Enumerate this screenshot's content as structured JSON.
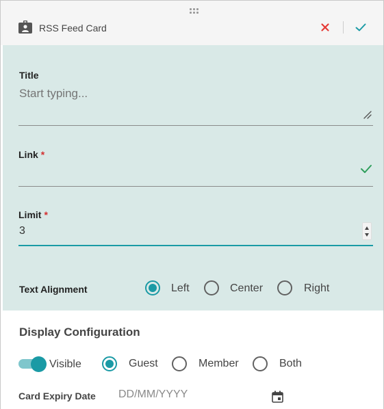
{
  "header": {
    "title": "RSS Feed Card",
    "icon": "id-badge-icon",
    "cancel_icon": "close-icon",
    "confirm_icon": "check-icon",
    "cancel_color": "#e53935",
    "confirm_color": "#1a9aa5"
  },
  "form": {
    "background": "#d9e9e7",
    "accent": "#1a9aa5",
    "title": {
      "label": "Title",
      "placeholder": "Start typing...",
      "value": ""
    },
    "link": {
      "label": "Link",
      "required_mark": "*",
      "value": "",
      "valid": true
    },
    "limit": {
      "label": "Limit",
      "required_mark": "*",
      "value": "3"
    },
    "text_alignment": {
      "label": "Text Alignment",
      "options": [
        "Left",
        "Center",
        "Right"
      ],
      "selected": "Left"
    }
  },
  "display": {
    "section_title": "Display Configuration",
    "visible_toggle": {
      "label": "Visible",
      "on": true
    },
    "audience": {
      "options": [
        "Guest",
        "Member",
        "Both"
      ],
      "selected": "Guest"
    },
    "expiry": {
      "label": "Card Expiry Date",
      "placeholder": "DD/MM/YYYY",
      "value": ""
    }
  }
}
